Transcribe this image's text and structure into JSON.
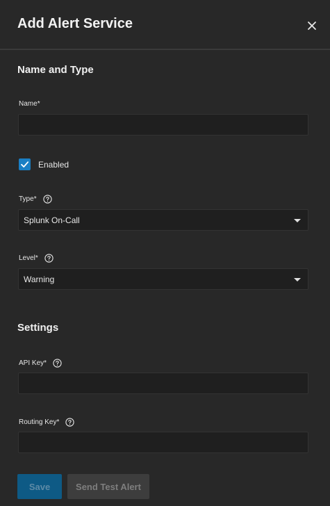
{
  "dialog": {
    "title": "Add Alert Service",
    "close_icon": "close-icon"
  },
  "sections": {
    "name_and_type": "Name and Type",
    "settings": "Settings"
  },
  "fields": {
    "name": {
      "label": "Name",
      "required_mark": "*",
      "value": ""
    },
    "enabled": {
      "label": "Enabled",
      "checked": true
    },
    "type": {
      "label": "Type",
      "required_mark": "*",
      "value": "Splunk On-Call",
      "help_icon": "help-circle-icon"
    },
    "level": {
      "label": "Level",
      "required_mark": "*",
      "value": "Warning",
      "help_icon": "help-circle-icon"
    },
    "api_key": {
      "label": "API Key",
      "required_mark": "*",
      "value": "",
      "help_icon": "help-circle-icon"
    },
    "routing_key": {
      "label": "Routing Key",
      "required_mark": "*",
      "value": "",
      "help_icon": "help-circle-icon"
    }
  },
  "buttons": {
    "save": "Save",
    "send_test_alert": "Send Test Alert"
  },
  "colors": {
    "background": "#282828",
    "field_background": "#1f1f1f",
    "accent": "#1a7fc4",
    "save_disabled": "#0e5a85",
    "test_disabled": "#3d3d3d"
  }
}
